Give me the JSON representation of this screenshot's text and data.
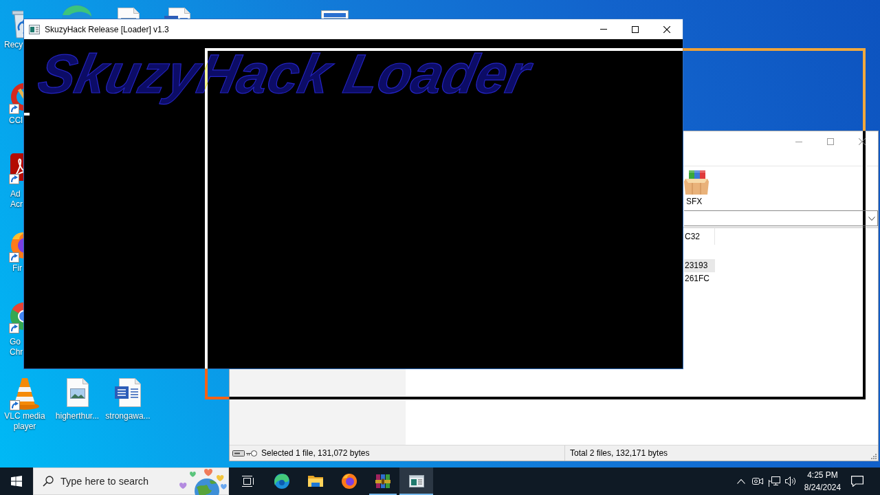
{
  "desktop": {
    "icons": [
      {
        "kind": "recycle-bin",
        "label": "Recy"
      },
      {
        "kind": "cleaner",
        "label": "CCl"
      },
      {
        "kind": "pdf-reader",
        "label": "Ad Acr"
      },
      {
        "kind": "firefox",
        "label": "Fir"
      },
      {
        "kind": "chrome",
        "label": "Go Chr"
      },
      {
        "kind": "vlc",
        "label": "VLC media player"
      },
      {
        "kind": "image-file",
        "label": "higherthur..."
      },
      {
        "kind": "word-file",
        "label": "strongawa..."
      }
    ],
    "covered_icons": [
      {
        "kind": "edge"
      },
      {
        "kind": "image-file"
      },
      {
        "kind": "word-file"
      },
      {
        "kind": "window-file"
      }
    ]
  },
  "console_window": {
    "title": "SkuzyHack Release [Loader] v1.3",
    "active": true,
    "banner": "SkuzyHack Loader"
  },
  "archive_window": {
    "active": false,
    "toolbar": [
      {
        "label": "SFX"
      }
    ],
    "file_list": {
      "columns": [
        "C32"
      ],
      "rows": [
        {
          "cells": [
            "23193"
          ],
          "selected": true
        },
        {
          "cells": [
            "261FC"
          ],
          "selected": false
        }
      ]
    },
    "status_bar": {
      "selection": "Selected 1 file, 131,072 bytes",
      "total": "Total 2 files, 132,171 bytes"
    }
  },
  "taskbar": {
    "search": {
      "placeholder": "Type here to search"
    },
    "apps": [
      {
        "kind": "edge",
        "running": false,
        "selected": false
      },
      {
        "kind": "explorer",
        "running": false,
        "selected": false
      },
      {
        "kind": "firefox",
        "running": false,
        "selected": false
      },
      {
        "kind": "winrar",
        "running": true,
        "selected": false
      },
      {
        "kind": "console",
        "running": true,
        "selected": true
      }
    ],
    "tray": [
      {
        "kind": "chevron"
      },
      {
        "kind": "meet-now"
      },
      {
        "kind": "network"
      },
      {
        "kind": "volume"
      }
    ],
    "clock": {
      "time": "4:25 PM",
      "date": "8/24/2024"
    }
  }
}
